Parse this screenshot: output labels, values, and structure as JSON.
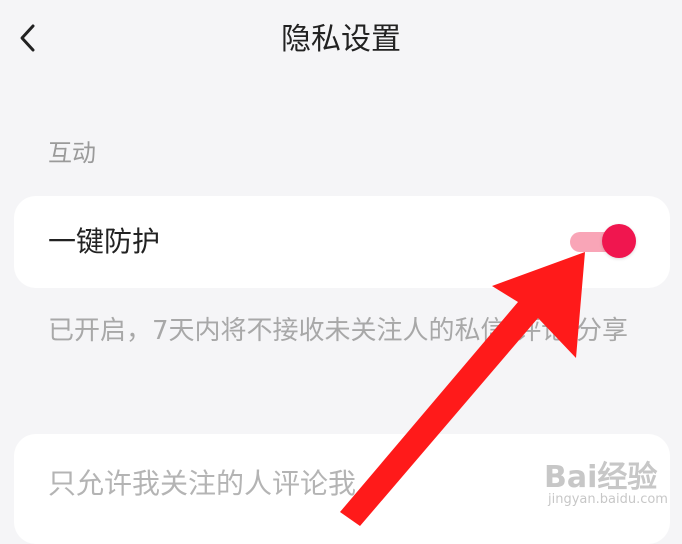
{
  "header": {
    "back_icon": "chevron-left-icon",
    "title": "隐私设置"
  },
  "section": {
    "label": "互动"
  },
  "protection": {
    "label": "一键防护",
    "toggle_state": "on",
    "accent_color": "#f0164f"
  },
  "description": "已开启，7天内将不接收未关注人的私信/评论/分享",
  "comment_setting": {
    "label": "只允许我关注的人评论我"
  },
  "watermark": {
    "brand": "Bai经验",
    "url": "jingyan.baidu.com"
  },
  "annotation": {
    "arrow_color": "#ff1a1a"
  }
}
